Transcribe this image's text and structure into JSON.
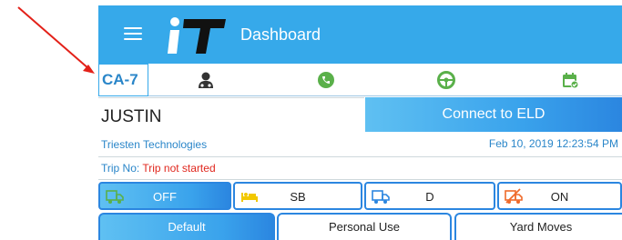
{
  "colors": {
    "primary": "#36a9ea",
    "accent_dark": "#2b86e0",
    "link_blue": "#2a86c9",
    "status_green": "#5ab04a",
    "status_yellow": "#f2c800",
    "status_orange": "#ef6a2a",
    "annotation_red": "#e32119"
  },
  "header": {
    "menu_icon": "hamburger-menu-icon",
    "logo_text": "iT",
    "title": "Dashboard"
  },
  "status_bar": {
    "unit_id": "CA-7",
    "icons": [
      "driver-profile-icon",
      "phone-sync-icon",
      "steering-wheel-icon",
      "calendar-check-icon"
    ]
  },
  "driver": {
    "name": "JUSTIN",
    "company": "Triesten Technologies"
  },
  "eld": {
    "connect_label": "Connect to ELD",
    "datetime": "Feb 10, 2019 12:23:54 PM"
  },
  "trip": {
    "label": "Trip No:",
    "status": "Trip not started"
  },
  "duty_status": {
    "selected": "OFF",
    "buttons": [
      {
        "label": "OFF",
        "icon": "truck-off-icon"
      },
      {
        "label": "SB",
        "icon": "sleeper-bed-icon"
      },
      {
        "label": "D",
        "icon": "truck-driving-icon"
      },
      {
        "label": "ON",
        "icon": "truck-on-duty-icon"
      }
    ]
  },
  "modes": {
    "selected": "Default",
    "tabs": [
      "Default",
      "Personal Use",
      "Yard Moves"
    ]
  }
}
